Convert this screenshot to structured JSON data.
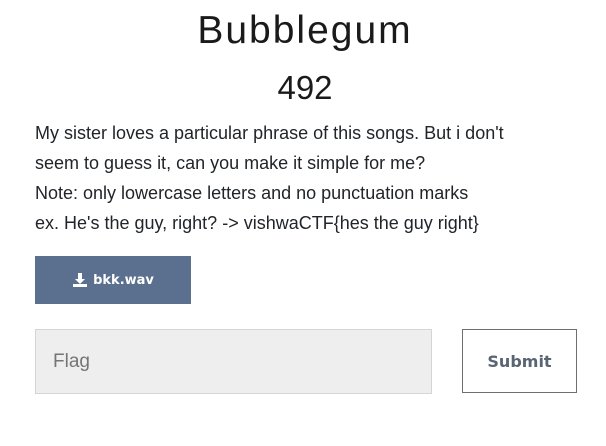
{
  "challenge": {
    "title": "Bubblegum",
    "value": "492",
    "description": [
      "My sister loves a particular phrase of this songs. But i don't",
      "seem to guess it, can you make it simple for me?",
      "Note: only lowercase letters and no punctuation marks",
      "ex. He's the guy, right? -> vishwaCTF{hes the guy right}"
    ]
  },
  "file": {
    "name": "bkk.wav",
    "icon": "download-icon"
  },
  "submission": {
    "placeholder": "Flag",
    "value": "",
    "submit_label": "Submit"
  },
  "colors": {
    "file_button_bg": "#5b708e",
    "input_bg": "#eeeeee",
    "submit_text": "#5a6573"
  }
}
